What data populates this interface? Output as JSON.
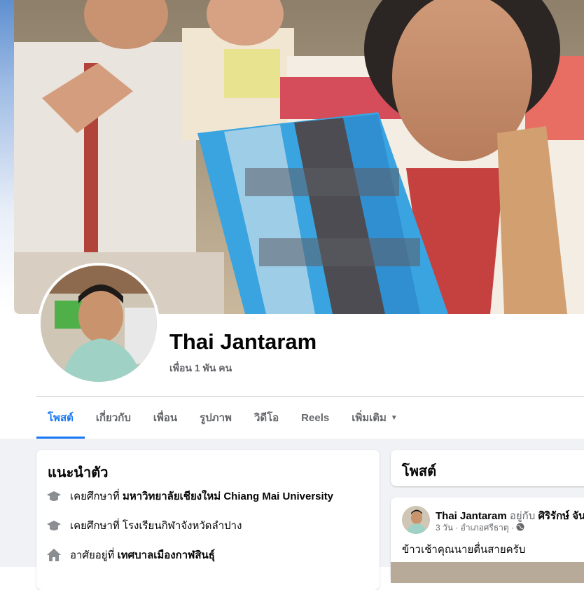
{
  "profile": {
    "name": "Thai Jantaram",
    "friends": "เพื่อน 1 พัน คน"
  },
  "tabs": [
    {
      "label": "โพสต์",
      "active": true
    },
    {
      "label": "เกี่ยวกับ"
    },
    {
      "label": "เพื่อน"
    },
    {
      "label": "รูปภาพ"
    },
    {
      "label": "วิดีโอ"
    },
    {
      "label": "Reels"
    },
    {
      "label": "เพิ่มเติม",
      "icon": "caret-down-icon"
    }
  ],
  "intro": {
    "title": "แนะนำตัว",
    "items": [
      {
        "icon": "graduation-cap-icon",
        "prefix": "เคยศึกษาที่ ",
        "value": "มหาวิทยาลัยเชียงใหม่ Chiang Mai University"
      },
      {
        "icon": "graduation-cap-icon",
        "prefix": "เคยศึกษาที่ โรงเรียนกิฬาจังหวัดลำปาง",
        "value": ""
      },
      {
        "icon": "home-icon",
        "prefix": "อาศัยอยู่ที่ ",
        "value": "เทศบาลเมืองกาฬสินธุ์"
      }
    ]
  },
  "posts_header": {
    "title": "โพสต์"
  },
  "post": {
    "author": "Thai Jantaram",
    "with_text": " อยู่กับ ",
    "tagged": "ศิริรักษ์ จันท",
    "time": "3 วัน · อำเภอศรีธาตุ ·",
    "privacy_icon": "globe-icon",
    "text": "ข้าวเช้าคุณนายตื่นสายครับ"
  },
  "colors": {
    "accent": "#1877f2",
    "secondary_text": "#65676b",
    "page_background": "#f0f2f5"
  }
}
